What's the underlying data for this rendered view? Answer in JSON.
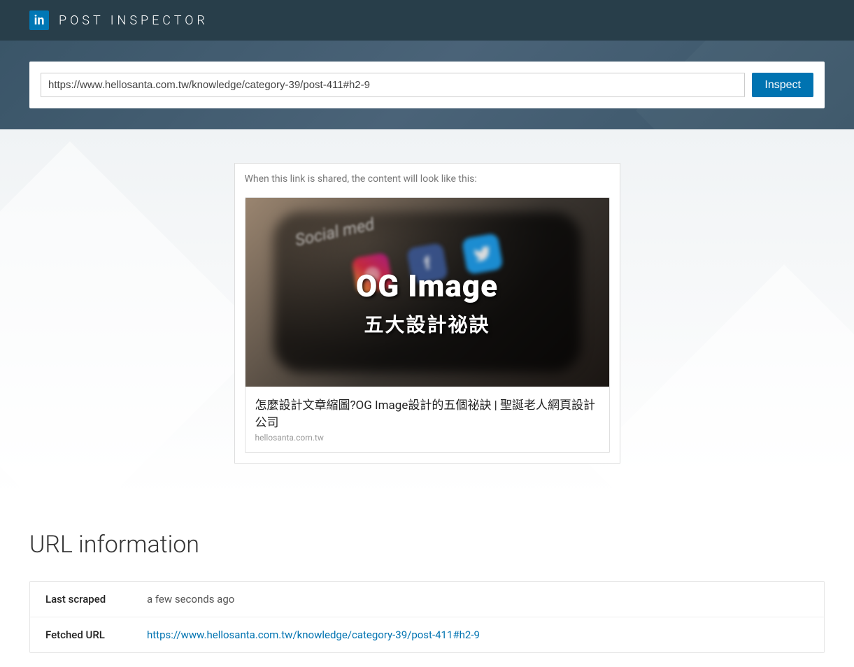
{
  "header": {
    "app_title": "POST INSPECTOR",
    "logo_text": "in"
  },
  "inspector": {
    "url_value": "https://www.hellosanta.com.tw/knowledge/category-39/post-411#h2-9",
    "inspect_label": "Inspect"
  },
  "preview": {
    "label": "When this link is shared, the content will look like this:",
    "image_overlay_title": "OG Image",
    "image_overlay_subtitle": "五大設計祕訣",
    "social_text": "Social med",
    "share_title": "怎麼設計文章縮圖?OG Image設計的五個祕訣 | 聖誕老人網頁設計公司",
    "share_domain": "hellosanta.com.tw"
  },
  "url_info": {
    "heading": "URL information",
    "rows": [
      {
        "key": "Last scraped",
        "value": "a few seconds ago",
        "is_link": false
      },
      {
        "key": "Fetched URL",
        "value": "https://www.hellosanta.com.tw/knowledge/category-39/post-411#h2-9",
        "is_link": true
      }
    ]
  }
}
